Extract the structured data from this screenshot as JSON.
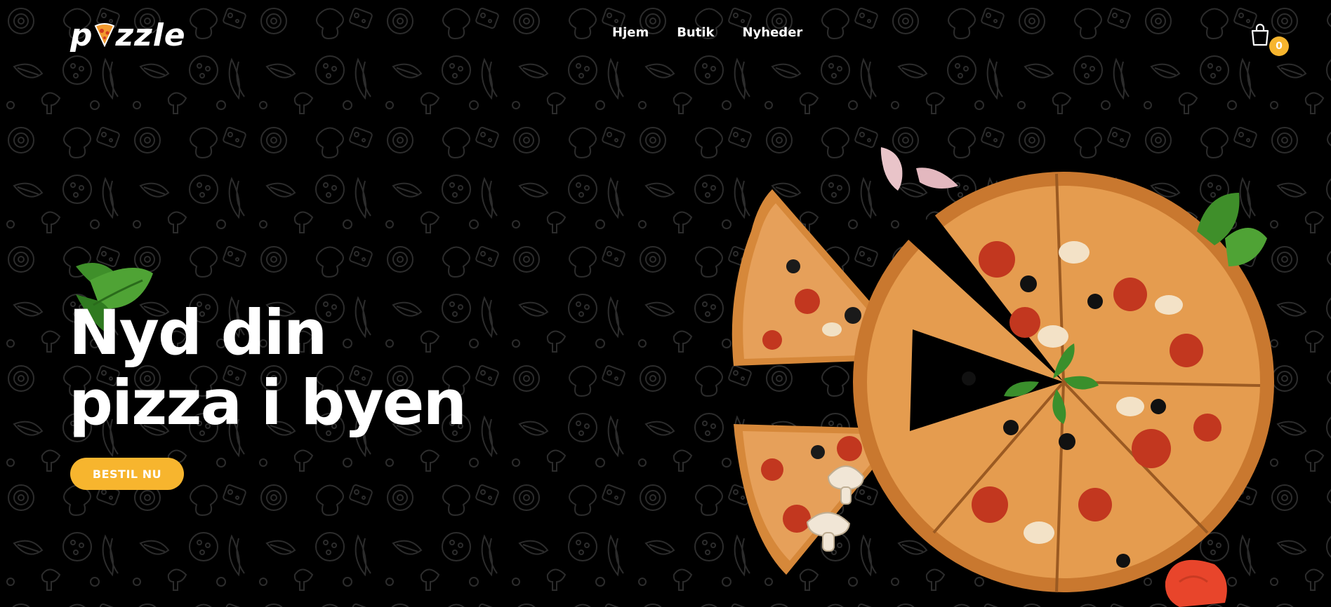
{
  "brand": {
    "logo_prefix": "p",
    "logo_suffix": "zzle",
    "logo_icon": "pizza-slice-icon"
  },
  "nav": {
    "items": [
      {
        "label": "Hjem"
      },
      {
        "label": "Butik"
      },
      {
        "label": "Nyheder"
      }
    ]
  },
  "cart": {
    "icon": "shopping-bag-icon",
    "count": "0"
  },
  "hero": {
    "title_line1": "Nyd din",
    "title_line2": "pizza i byen",
    "cta_label": "BESTIL NU"
  },
  "colors": {
    "background": "#000000",
    "accent": "#f7b52e",
    "text": "#ffffff",
    "pattern": "#2a2a2a"
  },
  "decor": {
    "pattern": "food-doodle-pattern",
    "images": [
      "basil-leaf",
      "garlic-clove",
      "pizza-slice",
      "mushroom",
      "tomato-slice",
      "whole-pizza"
    ]
  }
}
